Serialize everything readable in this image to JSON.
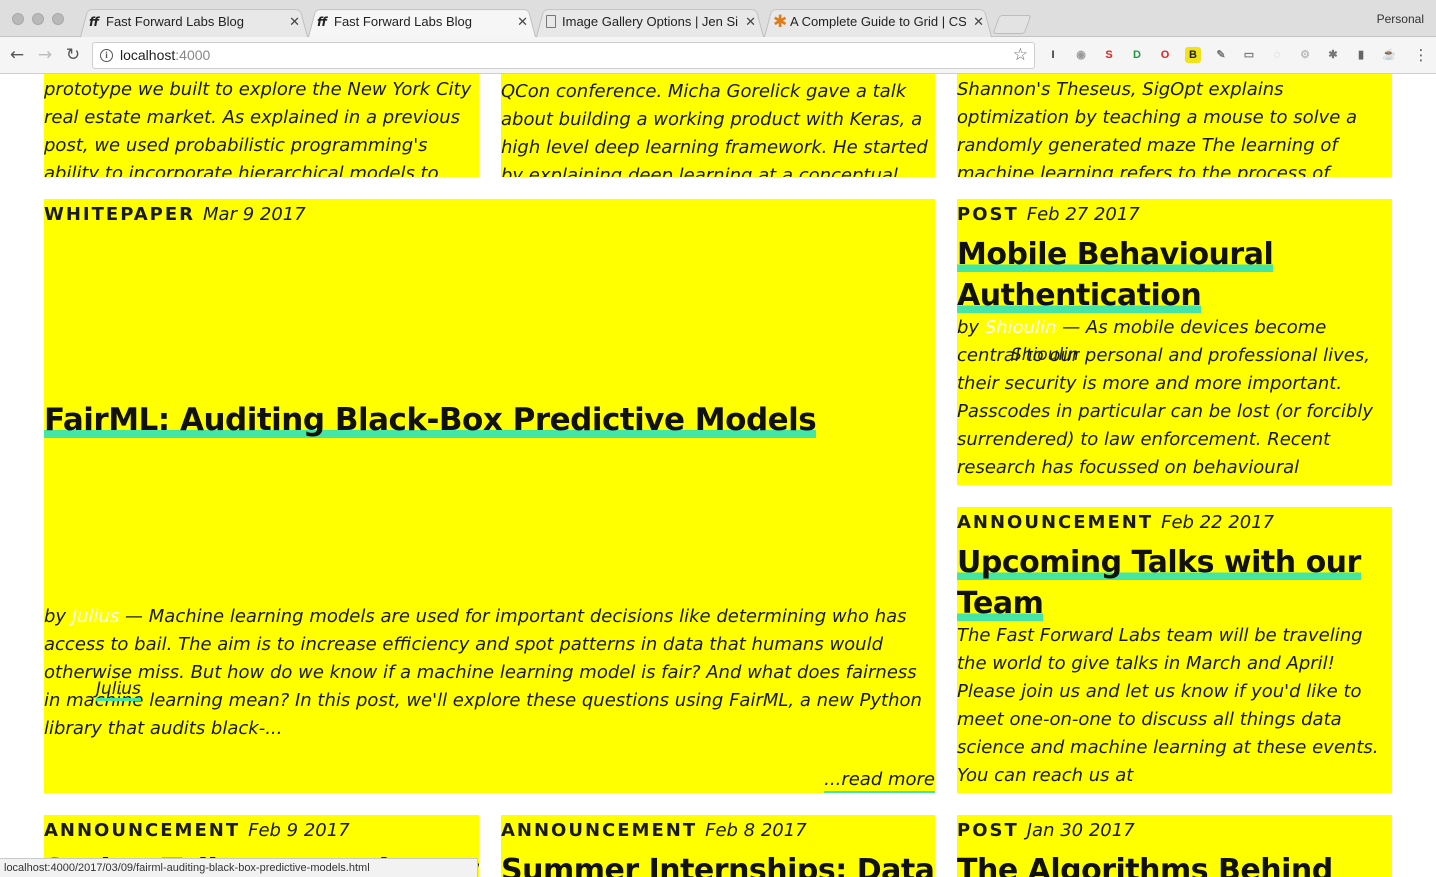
{
  "browser": {
    "tabs": [
      {
        "title": "Fast Forward Labs Blog",
        "favicon": "ff-logo-icon"
      },
      {
        "title": "Fast Forward Labs Blog",
        "favicon": "ff-logo-icon",
        "active": true
      },
      {
        "title": "Image Gallery Options | Jen Si",
        "favicon": "document-icon"
      },
      {
        "title": "A Complete Guide to Grid | CS",
        "favicon": "css-tricks-star-icon"
      }
    ],
    "tab_close": "✕",
    "profile": "Personal",
    "url_host": "localhost",
    "url_port": ":4000",
    "status_url": "localhost:4000/2017/03/09/fairml-auditing-black-box-predictive-models.html",
    "extensions": [
      "I",
      "◉",
      "S",
      "D",
      "O",
      "B",
      "✎",
      "▭",
      "◌",
      "⚙",
      "✱",
      "▮",
      "☕"
    ]
  },
  "top_row": [
    {
      "text": "prototype we built to explore the New York City real estate market. As explained in a previous post, we used probabilistic programming's ability to incorporate hierarchical models to make"
    },
    {
      "text": "QCon conference. Micha Gorelick gave a talk about building a working product with Keras, a high level deep learning framework. He started by explaining deep learning at a conceptual level"
    },
    {
      "text": "Shannon's Theseus, SigOpt explains optimization by teaching a mouse to solve a randomly generated maze The learning of machine learning refers to the process of updating and tuning the"
    }
  ],
  "featured": {
    "kind": "WHITEPAPER",
    "date": "Mar 9 2017",
    "title": "FairML: Auditing Black-Box Predictive Models",
    "by": "by",
    "author": "Julius",
    "excerpt": " — Machine learning models are used for important decisions like determining who has access to bail. The aim is to increase efficiency and spot patterns in data that humans would otherwise miss. But how do we know if a machine learning model is fair? And what does fairness in machine learning mean? In this post, we'll explore these questions using FairML, a new Python library that audits black-...",
    "stray_author": "Julius",
    "read_more": "...read more"
  },
  "side_posts": [
    {
      "kind": "POST",
      "date": "Feb 27 2017",
      "title": "Mobile Behavioural Authentication",
      "by": "by",
      "author": "Shioulin",
      "stray_author": "Shioulin",
      "excerpt": " — As mobile devices become central to our personal and professional lives, their security is more and more important. Passcodes in particular can be lost (or forcibly surrendered) to law enforcement. Recent research has focussed on behavioural authentication based on patterns"
    },
    {
      "kind": "ANNOUNCEMENT",
      "date": "Feb 22 2017",
      "title": "Upcoming Talks with our Team",
      "excerpt": "The Fast Forward Labs team will be traveling the world to give talks in March and April! Please join us and let us know if you'd like to meet one-on-one to discuss all things data science and machine learning at these events. You can reach us at contact@fastforwardlabs.com to schedule a"
    }
  ],
  "bottom_row": [
    {
      "kind": "ANNOUNCEMENT",
      "date": "Feb 9 2017",
      "title": "Spring Talks: Upcoming Events"
    },
    {
      "kind": "ANNOUNCEMENT",
      "date": "Feb 8 2017",
      "title": "Summer Internships: Data"
    },
    {
      "kind": "POST",
      "date": "Jan 30 2017",
      "title": "The Algorithms Behind"
    }
  ],
  "colors": {
    "card": "#ffff00",
    "underline": "#44e6a6",
    "author": "#ffffff"
  }
}
